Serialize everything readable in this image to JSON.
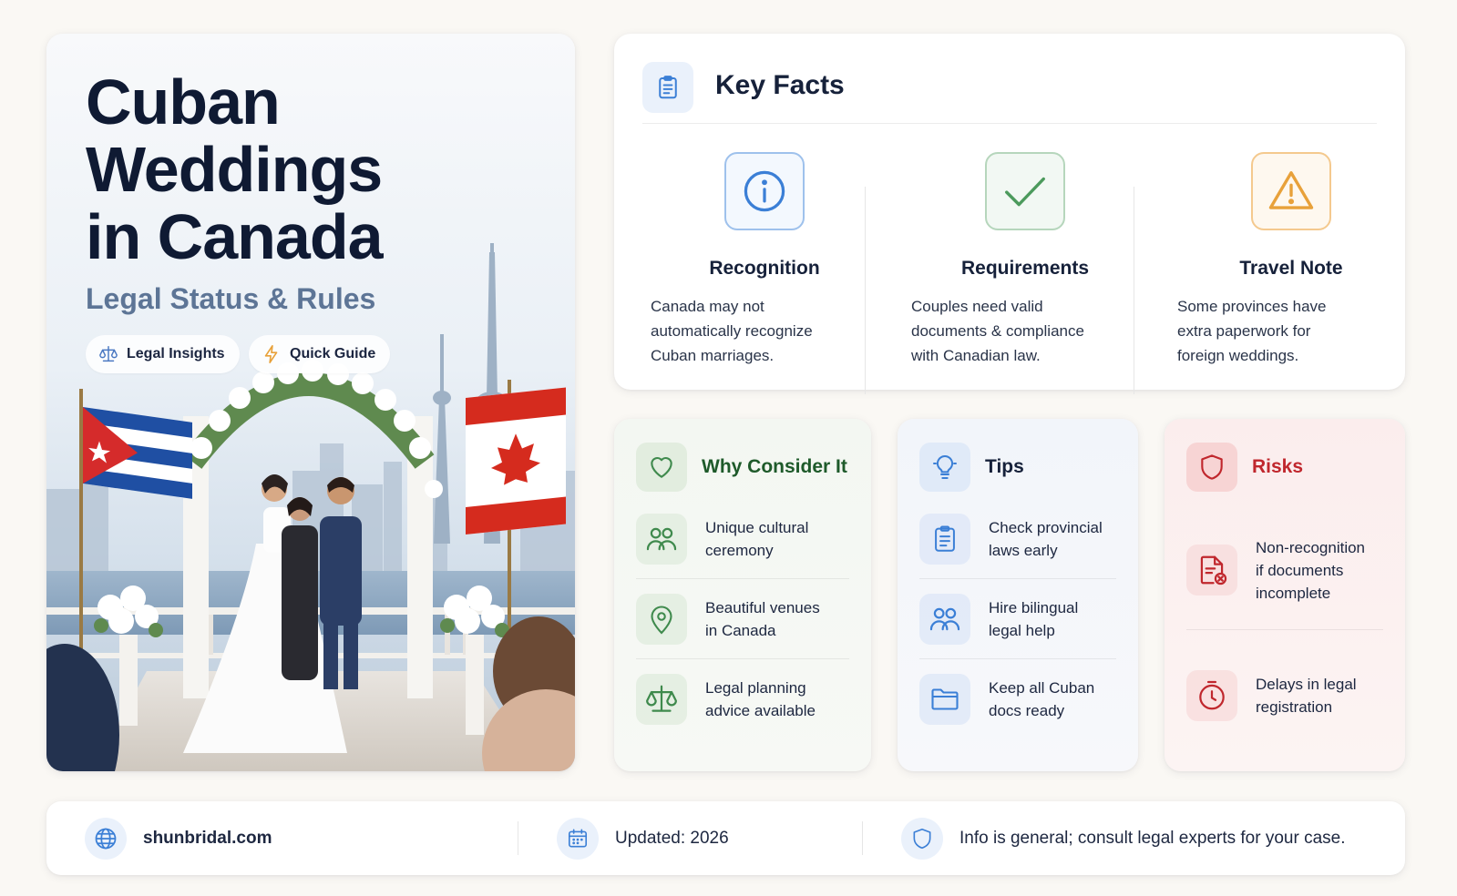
{
  "hero": {
    "title_lines": [
      "Cuban",
      "Weddings",
      "in Canada"
    ],
    "subtitle": "Legal Status & Rules",
    "pills": [
      {
        "label": "Legal Insights",
        "icon": "scales-icon"
      },
      {
        "label": "Quick Guide",
        "icon": "lightning-icon"
      }
    ]
  },
  "key_facts": {
    "title": "Key Facts",
    "icon": "clipboard-icon",
    "facts": [
      {
        "icon": "info-icon",
        "name": "Recognition",
        "desc_lines": [
          "Canada may not",
          "automatically recognize",
          "Cuban marriages."
        ],
        "color": "#3b7fd6"
      },
      {
        "icon": "check-icon",
        "name": "Requirements",
        "desc_lines": [
          "Couples need valid",
          "documents & compliance",
          "with Canadian law."
        ],
        "color": "#4c9a5c"
      },
      {
        "icon": "warning-icon",
        "name": "Travel Note",
        "desc_lines": [
          "Some provinces have",
          "extra paperwork for",
          "foreign weddings."
        ],
        "color": "#e8a13a"
      }
    ]
  },
  "why": {
    "title": "Why Consider It",
    "icon": "heart-icon",
    "color": "#1e5a2a",
    "items": [
      {
        "icon": "people-icon",
        "lines": [
          "Unique cultural",
          "ceremony"
        ]
      },
      {
        "icon": "location-pin-icon",
        "lines": [
          "Beautiful venues",
          "in Canada"
        ]
      },
      {
        "icon": "scales-icon",
        "lines": [
          "Legal planning",
          "advice available"
        ]
      }
    ]
  },
  "tips": {
    "title": "Tips",
    "icon": "lightbulb-icon",
    "items": [
      {
        "icon": "clipboard-icon",
        "lines": [
          "Check provincial",
          "laws early"
        ]
      },
      {
        "icon": "people-icon",
        "lines": [
          "Hire bilingual",
          "legal help"
        ]
      },
      {
        "icon": "folder-icon",
        "lines": [
          "Keep all Cuban",
          "docs ready"
        ]
      }
    ]
  },
  "risks": {
    "title": "Risks",
    "icon": "shield-icon",
    "color": "#c0272d",
    "items": [
      {
        "icon": "document-error-icon",
        "lines": [
          "Non-recognition",
          "if documents",
          "incomplete"
        ]
      },
      {
        "icon": "timer-icon",
        "lines": [
          "Delays in legal",
          "registration"
        ]
      }
    ]
  },
  "footer": {
    "site": "shunbridal.com",
    "updated": "Updated: 2026",
    "disclaimer": "Info is general; consult legal experts for your case."
  }
}
